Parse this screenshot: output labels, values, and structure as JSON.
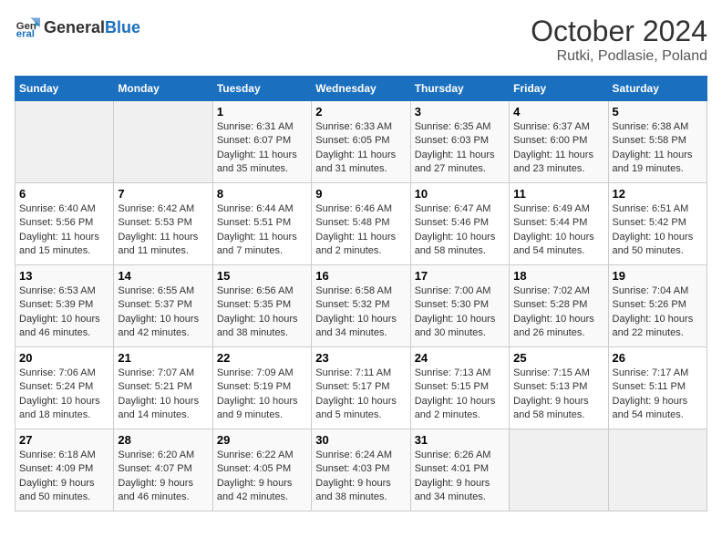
{
  "logo": {
    "general": "General",
    "blue": "Blue"
  },
  "title": "October 2024",
  "subtitle": "Rutki, Podlasie, Poland",
  "days_of_week": [
    "Sunday",
    "Monday",
    "Tuesday",
    "Wednesday",
    "Thursday",
    "Friday",
    "Saturday"
  ],
  "weeks": [
    [
      {
        "day": "",
        "info": ""
      },
      {
        "day": "",
        "info": ""
      },
      {
        "day": "1",
        "sunrise": "Sunrise: 6:31 AM",
        "sunset": "Sunset: 6:07 PM",
        "daylight": "Daylight: 11 hours and 35 minutes."
      },
      {
        "day": "2",
        "sunrise": "Sunrise: 6:33 AM",
        "sunset": "Sunset: 6:05 PM",
        "daylight": "Daylight: 11 hours and 31 minutes."
      },
      {
        "day": "3",
        "sunrise": "Sunrise: 6:35 AM",
        "sunset": "Sunset: 6:03 PM",
        "daylight": "Daylight: 11 hours and 27 minutes."
      },
      {
        "day": "4",
        "sunrise": "Sunrise: 6:37 AM",
        "sunset": "Sunset: 6:00 PM",
        "daylight": "Daylight: 11 hours and 23 minutes."
      },
      {
        "day": "5",
        "sunrise": "Sunrise: 6:38 AM",
        "sunset": "Sunset: 5:58 PM",
        "daylight": "Daylight: 11 hours and 19 minutes."
      }
    ],
    [
      {
        "day": "6",
        "sunrise": "Sunrise: 6:40 AM",
        "sunset": "Sunset: 5:56 PM",
        "daylight": "Daylight: 11 hours and 15 minutes."
      },
      {
        "day": "7",
        "sunrise": "Sunrise: 6:42 AM",
        "sunset": "Sunset: 5:53 PM",
        "daylight": "Daylight: 11 hours and 11 minutes."
      },
      {
        "day": "8",
        "sunrise": "Sunrise: 6:44 AM",
        "sunset": "Sunset: 5:51 PM",
        "daylight": "Daylight: 11 hours and 7 minutes."
      },
      {
        "day": "9",
        "sunrise": "Sunrise: 6:46 AM",
        "sunset": "Sunset: 5:48 PM",
        "daylight": "Daylight: 11 hours and 2 minutes."
      },
      {
        "day": "10",
        "sunrise": "Sunrise: 6:47 AM",
        "sunset": "Sunset: 5:46 PM",
        "daylight": "Daylight: 10 hours and 58 minutes."
      },
      {
        "day": "11",
        "sunrise": "Sunrise: 6:49 AM",
        "sunset": "Sunset: 5:44 PM",
        "daylight": "Daylight: 10 hours and 54 minutes."
      },
      {
        "day": "12",
        "sunrise": "Sunrise: 6:51 AM",
        "sunset": "Sunset: 5:42 PM",
        "daylight": "Daylight: 10 hours and 50 minutes."
      }
    ],
    [
      {
        "day": "13",
        "sunrise": "Sunrise: 6:53 AM",
        "sunset": "Sunset: 5:39 PM",
        "daylight": "Daylight: 10 hours and 46 minutes."
      },
      {
        "day": "14",
        "sunrise": "Sunrise: 6:55 AM",
        "sunset": "Sunset: 5:37 PM",
        "daylight": "Daylight: 10 hours and 42 minutes."
      },
      {
        "day": "15",
        "sunrise": "Sunrise: 6:56 AM",
        "sunset": "Sunset: 5:35 PM",
        "daylight": "Daylight: 10 hours and 38 minutes."
      },
      {
        "day": "16",
        "sunrise": "Sunrise: 6:58 AM",
        "sunset": "Sunset: 5:32 PM",
        "daylight": "Daylight: 10 hours and 34 minutes."
      },
      {
        "day": "17",
        "sunrise": "Sunrise: 7:00 AM",
        "sunset": "Sunset: 5:30 PM",
        "daylight": "Daylight: 10 hours and 30 minutes."
      },
      {
        "day": "18",
        "sunrise": "Sunrise: 7:02 AM",
        "sunset": "Sunset: 5:28 PM",
        "daylight": "Daylight: 10 hours and 26 minutes."
      },
      {
        "day": "19",
        "sunrise": "Sunrise: 7:04 AM",
        "sunset": "Sunset: 5:26 PM",
        "daylight": "Daylight: 10 hours and 22 minutes."
      }
    ],
    [
      {
        "day": "20",
        "sunrise": "Sunrise: 7:06 AM",
        "sunset": "Sunset: 5:24 PM",
        "daylight": "Daylight: 10 hours and 18 minutes."
      },
      {
        "day": "21",
        "sunrise": "Sunrise: 7:07 AM",
        "sunset": "Sunset: 5:21 PM",
        "daylight": "Daylight: 10 hours and 14 minutes."
      },
      {
        "day": "22",
        "sunrise": "Sunrise: 7:09 AM",
        "sunset": "Sunset: 5:19 PM",
        "daylight": "Daylight: 10 hours and 9 minutes."
      },
      {
        "day": "23",
        "sunrise": "Sunrise: 7:11 AM",
        "sunset": "Sunset: 5:17 PM",
        "daylight": "Daylight: 10 hours and 5 minutes."
      },
      {
        "day": "24",
        "sunrise": "Sunrise: 7:13 AM",
        "sunset": "Sunset: 5:15 PM",
        "daylight": "Daylight: 10 hours and 2 minutes."
      },
      {
        "day": "25",
        "sunrise": "Sunrise: 7:15 AM",
        "sunset": "Sunset: 5:13 PM",
        "daylight": "Daylight: 9 hours and 58 minutes."
      },
      {
        "day": "26",
        "sunrise": "Sunrise: 7:17 AM",
        "sunset": "Sunset: 5:11 PM",
        "daylight": "Daylight: 9 hours and 54 minutes."
      }
    ],
    [
      {
        "day": "27",
        "sunrise": "Sunrise: 6:18 AM",
        "sunset": "Sunset: 4:09 PM",
        "daylight": "Daylight: 9 hours and 50 minutes."
      },
      {
        "day": "28",
        "sunrise": "Sunrise: 6:20 AM",
        "sunset": "Sunset: 4:07 PM",
        "daylight": "Daylight: 9 hours and 46 minutes."
      },
      {
        "day": "29",
        "sunrise": "Sunrise: 6:22 AM",
        "sunset": "Sunset: 4:05 PM",
        "daylight": "Daylight: 9 hours and 42 minutes."
      },
      {
        "day": "30",
        "sunrise": "Sunrise: 6:24 AM",
        "sunset": "Sunset: 4:03 PM",
        "daylight": "Daylight: 9 hours and 38 minutes."
      },
      {
        "day": "31",
        "sunrise": "Sunrise: 6:26 AM",
        "sunset": "Sunset: 4:01 PM",
        "daylight": "Daylight: 9 hours and 34 minutes."
      },
      {
        "day": "",
        "info": ""
      },
      {
        "day": "",
        "info": ""
      }
    ]
  ]
}
